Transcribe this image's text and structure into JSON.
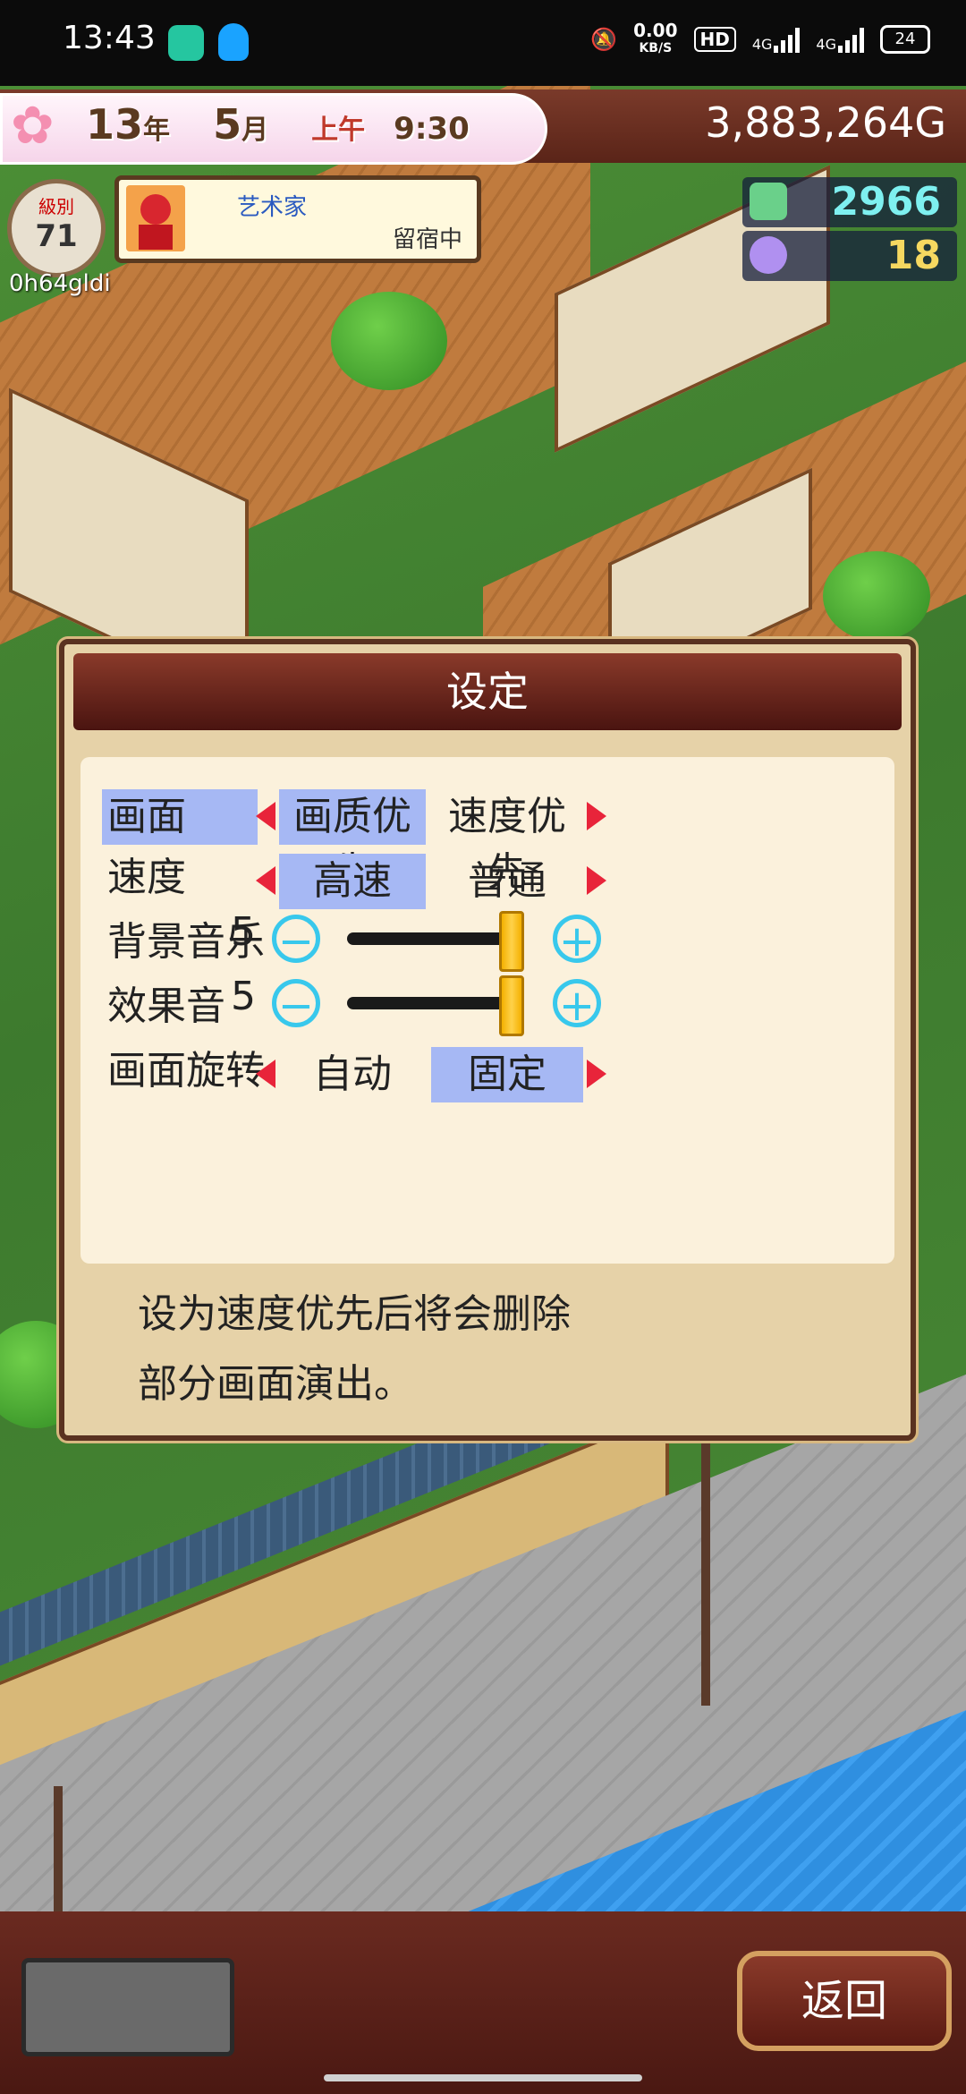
{
  "status_bar": {
    "time": "13:43",
    "net_speed": "0.00",
    "net_unit": "KB/S",
    "hd": "HD",
    "sig1": "4G",
    "sig2": "4G",
    "battery": "24"
  },
  "hud": {
    "year": "13",
    "year_unit": "年",
    "month": "5",
    "month_unit": "月",
    "ampm": "上午",
    "clock": "9:30",
    "money": "3,883,264G",
    "level_label": "級別",
    "level": "71",
    "player_name": "0h64gldi",
    "guest_name": "艺术家",
    "guest_status": "留宿中",
    "stat1": "2966",
    "stat2": "18"
  },
  "settings": {
    "title": "设定",
    "rows": {
      "screen": {
        "label": "画面",
        "opt1": "画质优先",
        "opt2": "速度优先"
      },
      "speed": {
        "label": "速度",
        "opt1": "高速",
        "opt2": "普通"
      },
      "bgm": {
        "label": "背景音乐",
        "value": "5"
      },
      "sfx": {
        "label": "效果音",
        "value": "5"
      },
      "rotation": {
        "label": "画面旋转",
        "opt1": "自动",
        "opt2": "固定"
      }
    },
    "description_line1": "设为速度优先后将会删除",
    "description_line2": "部分画面演出。"
  },
  "bottom": {
    "back_label": "返回"
  },
  "levels": {
    "bgm": 1.0,
    "sfx": 1.0
  },
  "colors": {
    "selection": "#a6b8f4",
    "arrow": "#e8243a",
    "adjust_button": "#38c8ec",
    "slider_knob": "#ffd24a",
    "title_bar": "#6a2418"
  }
}
